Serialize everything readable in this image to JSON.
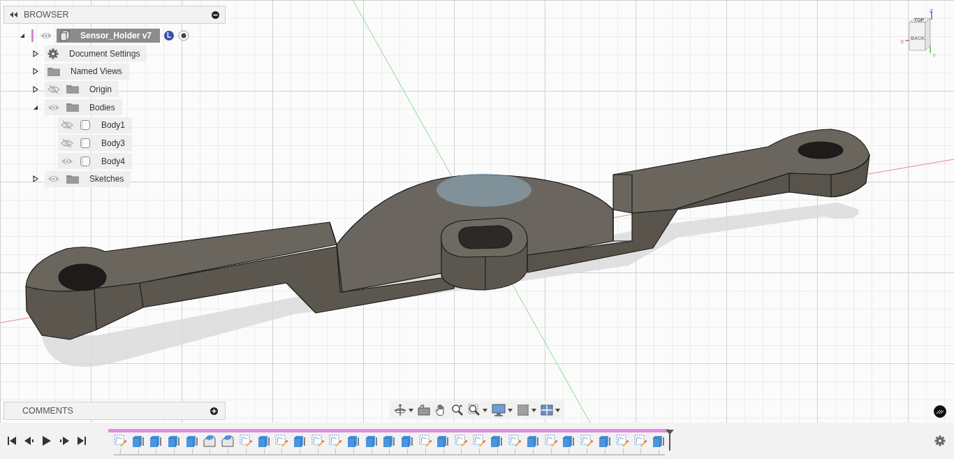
{
  "browser": {
    "title": "BROWSER",
    "tree": [
      {
        "label": "Sensor_Holder v7",
        "kind": "component",
        "expanded": true,
        "visible": true,
        "badge": "L",
        "children": [
          {
            "label": "Document Settings",
            "kind": "settings",
            "expanded": false
          },
          {
            "label": "Named Views",
            "kind": "folder",
            "expanded": false
          },
          {
            "label": "Origin",
            "kind": "folder",
            "expanded": false,
            "visible": false
          },
          {
            "label": "Bodies",
            "kind": "folder",
            "expanded": true,
            "visible": true,
            "children": [
              {
                "label": "Body1",
                "kind": "body",
                "visible": false
              },
              {
                "label": "Body3",
                "kind": "body",
                "visible": false
              },
              {
                "label": "Body4",
                "kind": "body",
                "visible": true
              }
            ]
          },
          {
            "label": "Sketches",
            "kind": "folder",
            "expanded": false,
            "visible": true
          }
        ]
      }
    ]
  },
  "comments": {
    "title": "COMMENTS"
  },
  "view_cube": {
    "face_top": "TOP",
    "face_front": "BACK",
    "axis_x": "X",
    "axis_y": "Y",
    "axis_z": "Z"
  },
  "timeline": {
    "items": [
      {
        "kind": "sketch"
      },
      {
        "kind": "extrude"
      },
      {
        "kind": "extrude"
      },
      {
        "kind": "extrude"
      },
      {
        "kind": "extrude"
      },
      {
        "kind": "fillet"
      },
      {
        "kind": "fillet"
      },
      {
        "kind": "sketch"
      },
      {
        "kind": "extrude"
      },
      {
        "kind": "sketch"
      },
      {
        "kind": "extrude"
      },
      {
        "kind": "sketch"
      },
      {
        "kind": "sketch"
      },
      {
        "kind": "extrude"
      },
      {
        "kind": "extrude"
      },
      {
        "kind": "extrude"
      },
      {
        "kind": "extrude"
      },
      {
        "kind": "sketch"
      },
      {
        "kind": "extrude"
      },
      {
        "kind": "sketch"
      },
      {
        "kind": "sketch"
      },
      {
        "kind": "extrude"
      },
      {
        "kind": "sketch"
      },
      {
        "kind": "extrude"
      },
      {
        "kind": "sketch"
      },
      {
        "kind": "extrude"
      },
      {
        "kind": "sketch"
      },
      {
        "kind": "extrude"
      },
      {
        "kind": "sketch"
      },
      {
        "kind": "sketch"
      },
      {
        "kind": "extrude"
      }
    ]
  }
}
